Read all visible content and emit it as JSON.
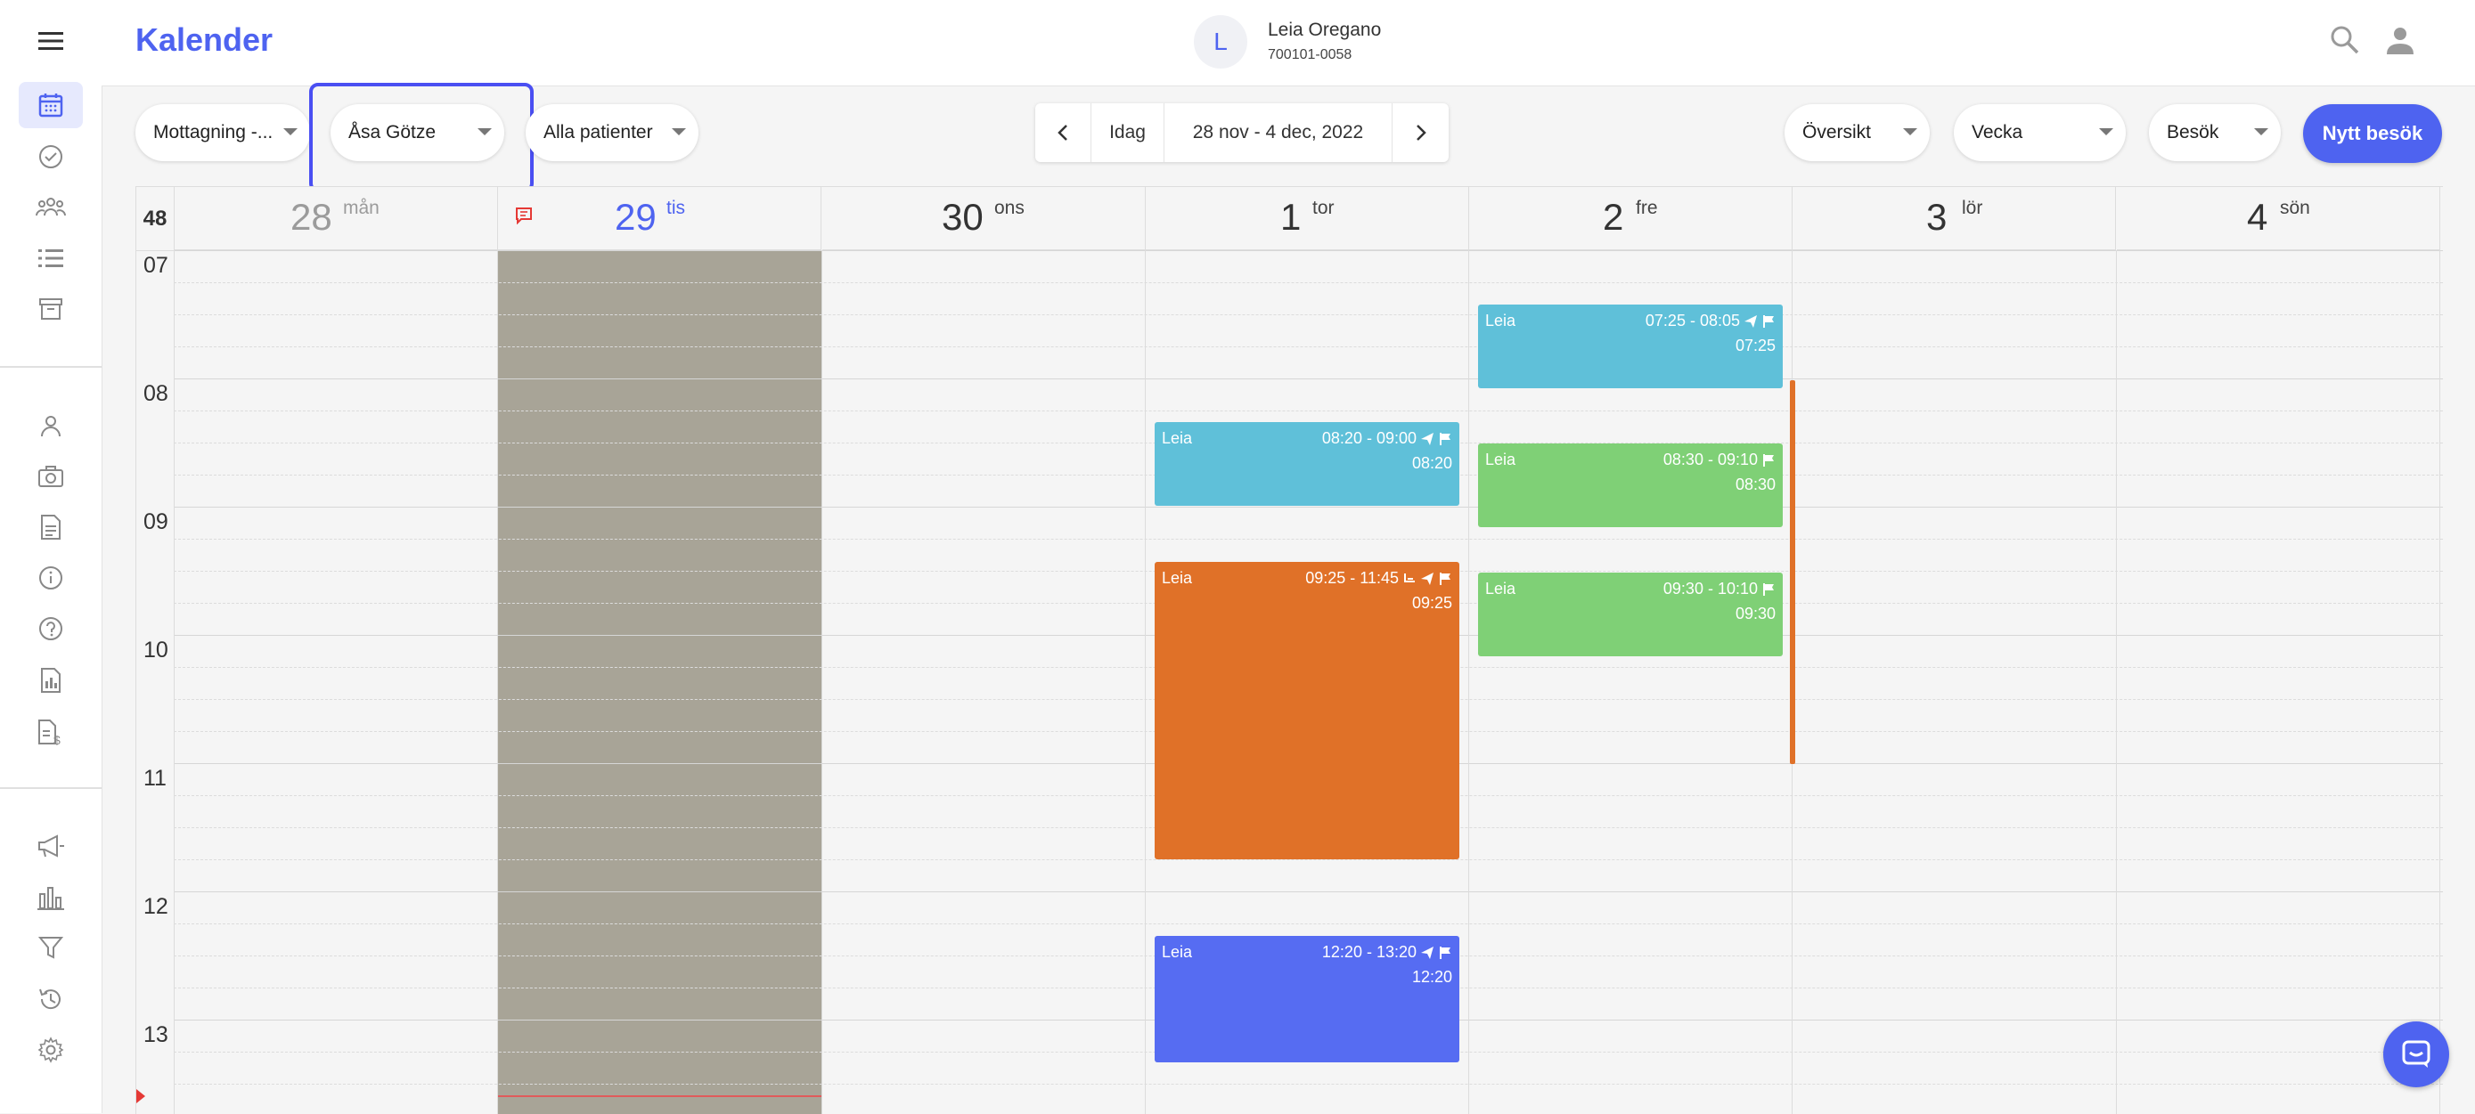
{
  "app": {
    "title": "Kalender"
  },
  "patient": {
    "initial": "L",
    "name": "Leia Oregano",
    "id": "700101-0058"
  },
  "toolbar": {
    "clinic_select": "Mottagning -...",
    "doctor_select": "Åsa Götze",
    "patient_select": "Alla patienter",
    "today_label": "Idag",
    "date_range": "28 nov - 4 dec, 2022",
    "overview_select": "Översikt",
    "view_select": "Vecka",
    "type_select": "Besök",
    "new_visit": "Nytt besök"
  },
  "calendar": {
    "week_number": "48",
    "days": [
      {
        "num": "28",
        "name": "mån"
      },
      {
        "num": "29",
        "name": "tis"
      },
      {
        "num": "30",
        "name": "ons"
      },
      {
        "num": "1",
        "name": "tor"
      },
      {
        "num": "2",
        "name": "fre"
      },
      {
        "num": "3",
        "name": "lör"
      },
      {
        "num": "4",
        "name": "sön"
      }
    ],
    "hours": [
      "07",
      "08",
      "09",
      "10",
      "11",
      "12",
      "13"
    ],
    "events": [
      {
        "who": "Leia",
        "time": "07:25 - 08:05",
        "start": "07:25",
        "color": "#5fc0d9"
      },
      {
        "who": "Leia",
        "time": "08:20 - 09:00",
        "start": "08:20",
        "color": "#5fc0d9"
      },
      {
        "who": "Leia",
        "time": "08:30 - 09:10",
        "start": "08:30",
        "color": "#7fd076"
      },
      {
        "who": "Leia",
        "time": "09:30 - 10:10",
        "start": "09:30",
        "color": "#7fd076"
      },
      {
        "who": "Leia",
        "time": "09:25 - 11:45",
        "start": "09:25",
        "color": "#e07128"
      },
      {
        "who": "Leia",
        "time": "12:20 - 13:20",
        "start": "12:20",
        "color": "#566cf2"
      }
    ]
  },
  "colors": {
    "accent": "#4e63f0",
    "today_shade": "#a8a497"
  }
}
